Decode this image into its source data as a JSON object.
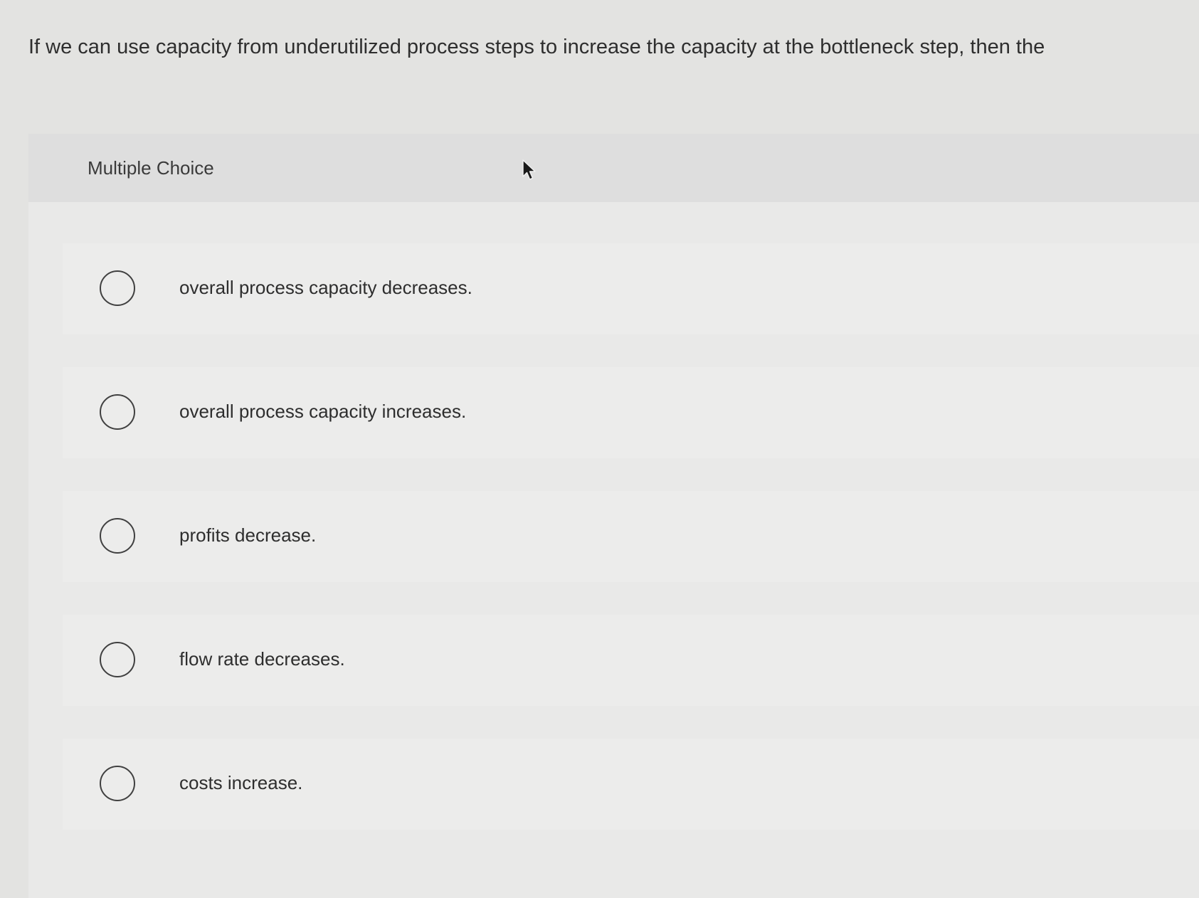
{
  "question": {
    "text": "If we can use capacity from underutilized process steps to increase the capacity at the bottleneck step, then the"
  },
  "panel": {
    "title": "Multiple Choice"
  },
  "options": [
    {
      "label": "overall process capacity decreases."
    },
    {
      "label": "overall process capacity increases."
    },
    {
      "label": "profits decrease."
    },
    {
      "label": "flow rate decreases."
    },
    {
      "label": "costs increase."
    }
  ],
  "icons": {
    "pointer": "mouse-pointer-icon",
    "radio": "radio-circle-icon"
  },
  "colors": {
    "background": "#e3e3e1",
    "panel": "#e9e9e8",
    "panel_header": "#dedede",
    "option_row": "#ececeb",
    "text": "#2e2e2e",
    "radio_border": "#404040"
  }
}
